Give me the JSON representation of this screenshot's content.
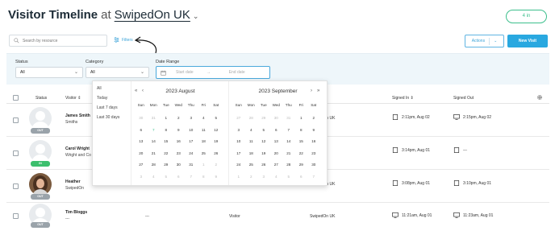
{
  "header": {
    "title": "Visitor Timeline",
    "at": "at",
    "org": "SwipedOn UK"
  },
  "count_badge": "4 in",
  "search": {
    "placeholder": "Search by resource"
  },
  "toolbar": {
    "filters_label": "Filters",
    "actions_label": "Actions",
    "new_visit_label": "New Visit"
  },
  "filters": {
    "status_label": "Status",
    "status_value": "All",
    "category_label": "Category",
    "category_value": "All",
    "date_range_label": "Date Range",
    "start_placeholder": "Start date",
    "end_placeholder": "End date",
    "range_arrow": "→"
  },
  "table": {
    "headers": {
      "status": "Status",
      "visitor": "Visitor",
      "signed_in": "Signed In",
      "signed_out": "Signed Out"
    },
    "rows": [
      {
        "name": "James Smith",
        "company": "Smiths",
        "badge": "OUT",
        "location": "SwipedOn UK",
        "signed_in": "2:11pm, Aug 02",
        "signed_out": "2:15pm, Aug 02"
      },
      {
        "name": "Carol Wright",
        "company": "Wright and Co",
        "badge": "IN",
        "location": "",
        "signed_in": "3:14pm, Aug 01",
        "signed_out": "---"
      },
      {
        "name": "Heather",
        "company": "SwipedOn",
        "badge": "OUT",
        "location": "SwipedOn UK",
        "signed_in": "3:08pm, Aug 01",
        "signed_out": "3:10pm, Aug 01"
      },
      {
        "name": "Tim Bloggs",
        "company": "---",
        "host": "---",
        "category": "Visitor",
        "badge": "OUT",
        "location": "SwipedOn UK",
        "signed_in": "11:21am, Aug 01",
        "signed_out": "11:23am, Aug 01"
      }
    ]
  },
  "datepicker": {
    "presets": [
      "All",
      "Today",
      "Last 7 days",
      "Last 30 days"
    ],
    "nav": {
      "prev_year": "«",
      "prev": "‹",
      "next": "›",
      "next_year": "»"
    },
    "weekdays": [
      "Sun",
      "Mon",
      "Tue",
      "Wed",
      "Thu",
      "Fri",
      "Sat"
    ],
    "months": [
      {
        "title": "2023 August",
        "weeks": [
          [
            "30",
            "31",
            "1",
            "2",
            "3",
            "4",
            "5"
          ],
          [
            "6",
            "7",
            "8",
            "9",
            "10",
            "11",
            "12"
          ],
          [
            "13",
            "14",
            "15",
            "16",
            "17",
            "18",
            "19"
          ],
          [
            "20",
            "21",
            "22",
            "23",
            "24",
            "25",
            "26"
          ],
          [
            "27",
            "28",
            "29",
            "30",
            "31",
            "1",
            "2"
          ],
          [
            "3",
            "4",
            "5",
            "6",
            "7",
            "8",
            "9"
          ]
        ],
        "muted": [
          [
            0,
            0
          ],
          [
            0,
            1
          ],
          [
            4,
            5
          ],
          [
            4,
            6
          ],
          [
            5,
            0
          ],
          [
            5,
            1
          ],
          [
            5,
            2
          ],
          [
            5,
            3
          ],
          [
            5,
            4
          ],
          [
            5,
            5
          ],
          [
            5,
            6
          ]
        ],
        "today": [
          1,
          1
        ]
      },
      {
        "title": "2023 September",
        "weeks": [
          [
            "27",
            "28",
            "29",
            "30",
            "31",
            "1",
            "2"
          ],
          [
            "3",
            "4",
            "5",
            "6",
            "7",
            "8",
            "9"
          ],
          [
            "10",
            "11",
            "12",
            "13",
            "14",
            "15",
            "16"
          ],
          [
            "17",
            "18",
            "19",
            "20",
            "21",
            "22",
            "23"
          ],
          [
            "24",
            "25",
            "26",
            "27",
            "28",
            "29",
            "30"
          ],
          [
            "1",
            "2",
            "3",
            "4",
            "5",
            "6",
            "7"
          ]
        ],
        "muted": [
          [
            0,
            0
          ],
          [
            0,
            1
          ],
          [
            0,
            2
          ],
          [
            0,
            3
          ],
          [
            0,
            4
          ],
          [
            5,
            0
          ],
          [
            5,
            1
          ],
          [
            5,
            2
          ],
          [
            5,
            3
          ],
          [
            5,
            4
          ],
          [
            5,
            5
          ],
          [
            5,
            6
          ]
        ],
        "today": null
      }
    ]
  },
  "colors": {
    "accent": "#29a8e0",
    "success": "#3cbf8c",
    "badge_out": "#9aa3aa",
    "badge_in": "#3cbf6d"
  }
}
